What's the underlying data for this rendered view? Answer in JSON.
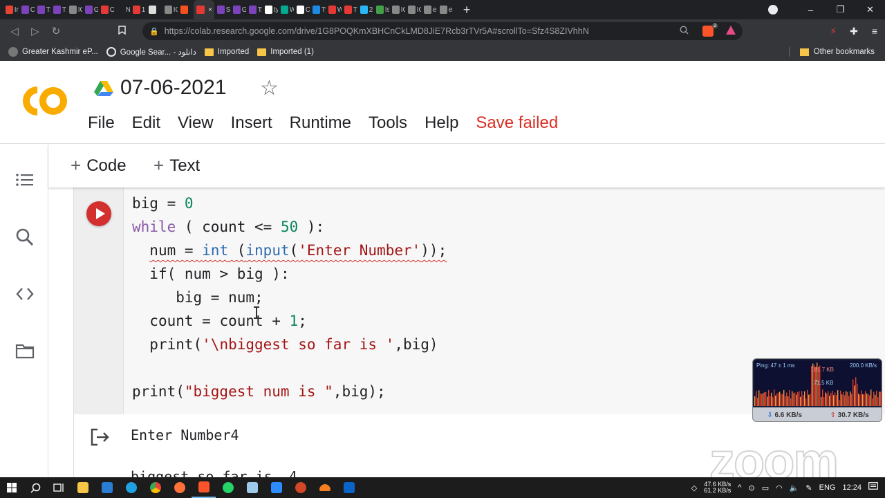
{
  "browser": {
    "tabs": [
      {
        "label": "In",
        "color": "#ea4335"
      },
      {
        "label": "C",
        "color": "#7b42bc"
      },
      {
        "label": "T:",
        "color": "#7b42bc"
      },
      {
        "label": "T:",
        "color": "#7b42bc"
      },
      {
        "label": "IC",
        "color": "#888888"
      },
      {
        "label": "G",
        "color": "#7b42bc"
      },
      {
        "label": "O",
        "color": "#e53935"
      },
      {
        "label": "New",
        "color": "#202124"
      },
      {
        "label": "1:",
        "color": "#e53935"
      },
      {
        "label": "",
        "color": "#dddddd"
      },
      {
        "label": "IC",
        "color": "#888888"
      },
      {
        "label": "",
        "color": "#f4511e"
      },
      {
        "label": "",
        "color": "#e53935"
      },
      {
        "label": "S\\",
        "color": "#7b42bc"
      },
      {
        "label": "G",
        "color": "#7b42bc"
      },
      {
        "label": "T:",
        "color": "#7b42bc"
      },
      {
        "label": "ty",
        "color": "#ffffff"
      },
      {
        "label": "W",
        "color": "#00a98f"
      },
      {
        "label": "C",
        "color": "#ffffff"
      },
      {
        "label": "Ty",
        "color": "#1e88e5"
      },
      {
        "label": "W",
        "color": "#e53935"
      },
      {
        "label": "Tl",
        "color": "#e53935"
      },
      {
        "label": "2(",
        "color": "#29b6f6"
      },
      {
        "label": "Is",
        "color": "#43a047"
      },
      {
        "label": "IC",
        "color": "#888888"
      },
      {
        "label": "IC",
        "color": "#888888"
      },
      {
        "label": "er",
        "color": "#888888"
      },
      {
        "label": "er",
        "color": "#888888"
      }
    ],
    "active_tab_close": "×",
    "new_tab": "+",
    "url": "https://colab.research.google.com/drive/1G8POQKmXBHCnCkLMD8JiE7Rcb3rTVr5A#scrollTo=Sfz4S8ZIVhhN",
    "window_controls": {
      "minimize": "–",
      "restore": "❐",
      "close": "✕"
    }
  },
  "bookmarks": {
    "items": [
      {
        "label": "Greater Kashmir eP...",
        "type": "site"
      },
      {
        "label": "Google Sear... - دانلود",
        "type": "google"
      },
      {
        "label": "Imported",
        "type": "folder"
      },
      {
        "label": "Imported (1)",
        "type": "folder"
      }
    ],
    "other": "Other bookmarks"
  },
  "colab": {
    "logo_text": "CO",
    "title": "07-06-2021",
    "menu": [
      "File",
      "Edit",
      "View",
      "Insert",
      "Runtime",
      "Tools",
      "Help"
    ],
    "save_status": "Save failed",
    "add_code": "Code",
    "add_text": "Text"
  },
  "code_cell": {
    "lines": [
      {
        "indent": "",
        "parts": [
          [
            "",
            "big = "
          ],
          [
            "num",
            "0"
          ]
        ]
      },
      {
        "indent": "",
        "parts": [
          [
            "kw",
            "while"
          ],
          [
            "",
            " ( count <= "
          ],
          [
            "num",
            "50"
          ],
          [
            "",
            " ):"
          ]
        ]
      },
      {
        "indent": "  ",
        "parts": [
          [
            "sq",
            "num = "
          ],
          [
            "sqbi",
            "int"
          ],
          [
            "sq",
            " ("
          ],
          [
            "sqbi",
            "input"
          ],
          [
            "sq",
            "("
          ],
          [
            "sqstr",
            "'Enter Number'"
          ],
          [
            "sq",
            "));"
          ]
        ]
      },
      {
        "indent": "  ",
        "parts": [
          [
            "",
            "if( num > big ):"
          ]
        ]
      },
      {
        "indent": "     ",
        "parts": [
          [
            "",
            "big = num;"
          ]
        ]
      },
      {
        "indent": "  ",
        "parts": [
          [
            "",
            "count = count + "
          ],
          [
            "num",
            "1"
          ],
          [
            "",
            ";"
          ]
        ]
      },
      {
        "indent": "  ",
        "parts": [
          [
            "",
            "print("
          ],
          [
            "str",
            "'\\nbiggest so far is '"
          ],
          [
            "",
            ",big)"
          ]
        ]
      },
      {
        "indent": "",
        "parts": [
          [
            "",
            ""
          ]
        ]
      },
      {
        "indent": "",
        "parts": [
          [
            "",
            "print("
          ],
          [
            "str",
            "\"biggest num is \""
          ],
          [
            "",
            ",big);"
          ]
        ]
      }
    ]
  },
  "output": {
    "line1": "Enter Number4",
    "line2": "biggest so far is  4"
  },
  "netwidget": {
    "ping": "Ping: 47 ± 1 ms",
    "peak1": "181.7 KB",
    "peak2": "71.5 KB",
    "max": "200.0 KB/s",
    "down": "6.6 KB/s",
    "up": "30.7 KB/s"
  },
  "zoom_watermark": "zoom",
  "taskbar": {
    "net_up": "47.6 KB/s",
    "net_down": "61.2 KB/s",
    "lang": "ENG",
    "time": "12:24"
  },
  "colors": {
    "accent_red": "#d93025",
    "colab_orange": "#f9ab00"
  }
}
